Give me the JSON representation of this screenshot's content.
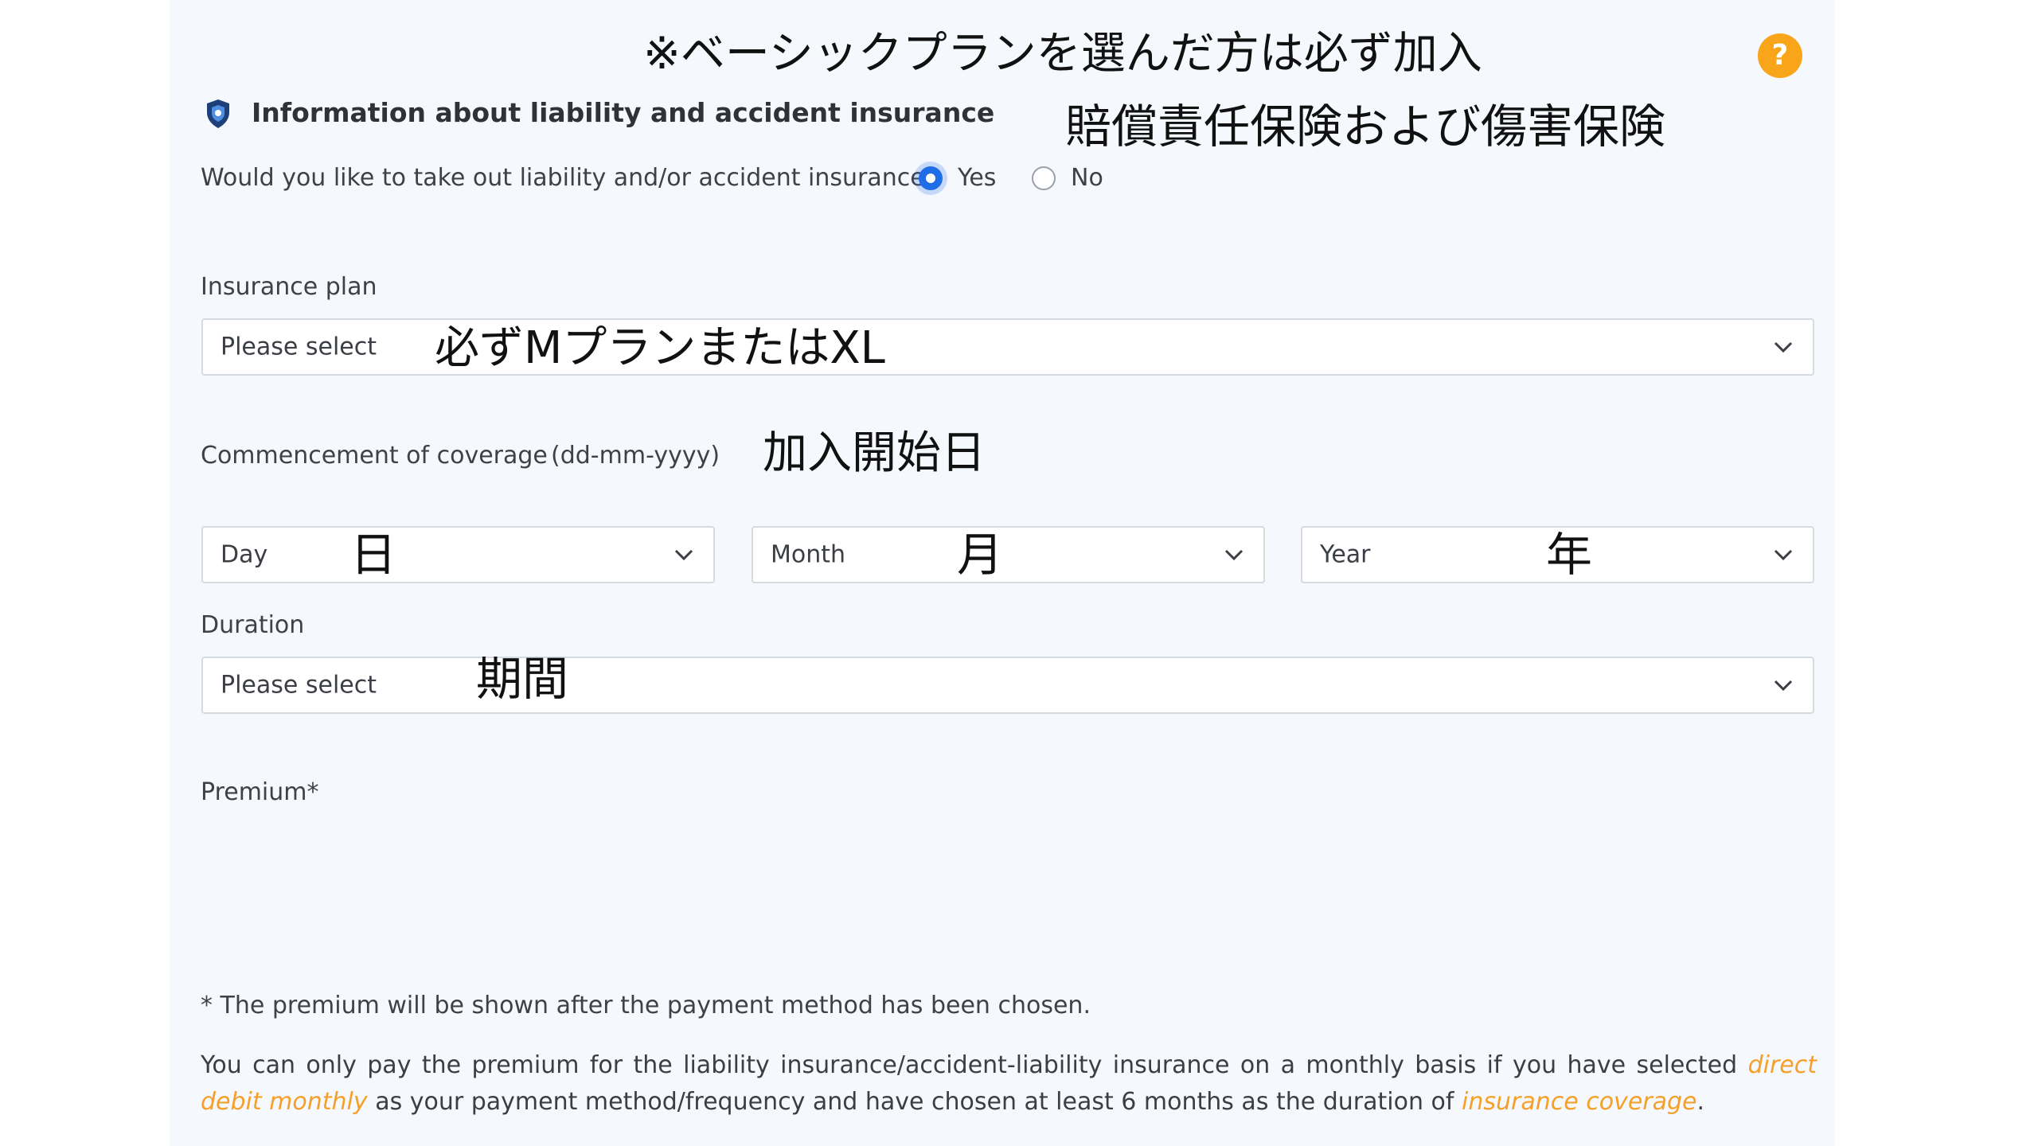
{
  "colors": {
    "panel_bg": "#f5f8fc",
    "accent_blue": "#1f6ee8",
    "link_orange": "#f5a02a",
    "help_orange": "#f9a51a",
    "shield_blue": "#1d3f7a"
  },
  "annotations": {
    "top_note": "※ベーシックプランを選んだ方は必ず加入",
    "section_jp": "賠償責任保険および傷害保険",
    "plan_jp": "必ずMプランまたはXL",
    "commencement_jp": "加入開始日",
    "day_jp": "日",
    "month_jp": "月",
    "year_jp": "年",
    "duration_jp": "期間"
  },
  "header": {
    "icon": "shield-icon",
    "title": "Information about liability and accident insurance",
    "help_icon": "question-icon",
    "help_symbol": "?"
  },
  "question": {
    "text": "Would you like to take out liability and/or accident insurance?",
    "options": [
      {
        "label": "Yes",
        "selected": true
      },
      {
        "label": "No",
        "selected": false
      }
    ]
  },
  "insurance_plan": {
    "label": "Insurance plan",
    "value": "Please select"
  },
  "commencement": {
    "label": "Commencement of coverage",
    "format_hint": "(dd-mm-yyyy)",
    "day": "Day",
    "month": "Month",
    "year": "Year"
  },
  "duration": {
    "label": "Duration",
    "value": "Please select"
  },
  "premium": {
    "label": "Premium*"
  },
  "footnote": {
    "line1": "* The premium will be shown after the payment method has been chosen.",
    "part1": "You can only pay the premium for the liability insurance/accident-liability insurance on a monthly basis if you have selected",
    "link1": "direct debit monthly",
    "part2": "as your payment method/frequency and have chosen at least 6 months as the duration of",
    "link2": "insurance coverage",
    "part3": "."
  }
}
